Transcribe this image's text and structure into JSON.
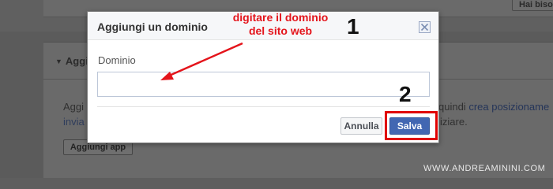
{
  "background": {
    "top_button_label": "Hai bisog",
    "card_heading": "Aggi",
    "card_text_line1": "Aggi",
    "card_text_line2": "invia",
    "right_text_line1_prefix": "quindi ",
    "right_text_line1_link": "crea posizioname",
    "right_text_line2": "iziare.",
    "add_app_button": "Aggiungi app"
  },
  "dialog": {
    "title": "Aggiungi un dominio",
    "field_label": "Dominio",
    "field_value": "",
    "field_placeholder": "",
    "cancel_label": "Annulla",
    "save_label": "Salva",
    "close_icon": "close-icon"
  },
  "annotations": {
    "hint_line1": "digitare il dominio",
    "hint_line2": "del sito web",
    "step1": "1",
    "step2": "2",
    "color": "#e4141b"
  },
  "watermark": "WWW.ANDREAMININI.COM",
  "colors": {
    "accent": "#4267b2",
    "annotation": "#e4141b",
    "overlay": "#5b5b5b"
  }
}
